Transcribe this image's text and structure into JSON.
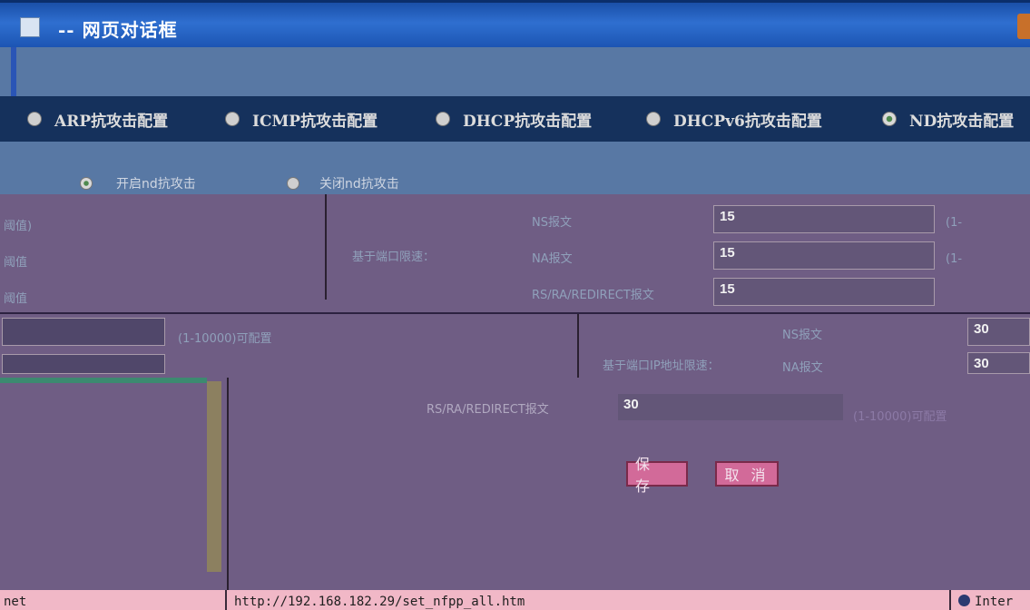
{
  "window": {
    "title": "-- 网页对话框"
  },
  "nav": {
    "tabs": [
      {
        "label": "ARP抗攻击配置",
        "selected": false
      },
      {
        "label": "ICMP抗攻击配置",
        "selected": false
      },
      {
        "label": "DHCP抗攻击配置",
        "selected": false
      },
      {
        "label": "DHCPv6抗攻击配置",
        "selected": false
      },
      {
        "label": "ND抗攻击配置",
        "selected": true
      }
    ]
  },
  "nd_options": {
    "enable_label": "开启nd抗攻击",
    "disable_label": "关闭nd抗攻击"
  },
  "section1": {
    "left_labels": [
      "阈值)",
      "阈值",
      "阈值"
    ],
    "center_label": "基于端口限速：",
    "rows": [
      {
        "label": "NS报文",
        "value": "15"
      },
      {
        "label": "NA报文",
        "value": "15"
      },
      {
        "label": "RS/RA/REDIRECT报文",
        "value": "15"
      }
    ]
  },
  "section2": {
    "range_label": "(1-10000)可配置",
    "center_label": "基于端口IP地址限速：",
    "rows": [
      {
        "label": "NS报文",
        "value": "30"
      },
      {
        "label": "NA报文",
        "value": "30"
      }
    ]
  },
  "section3": {
    "label": "RS/RA/REDIRECT报文",
    "value": "30",
    "range_label": "(1-10000)可配置"
  },
  "buttons": {
    "save": "保 存",
    "cancel": "取 消"
  },
  "statusbar": {
    "left": "net",
    "url": "http://192.168.182.29/set_nfpp_all.htm",
    "zone": "Inter"
  }
}
